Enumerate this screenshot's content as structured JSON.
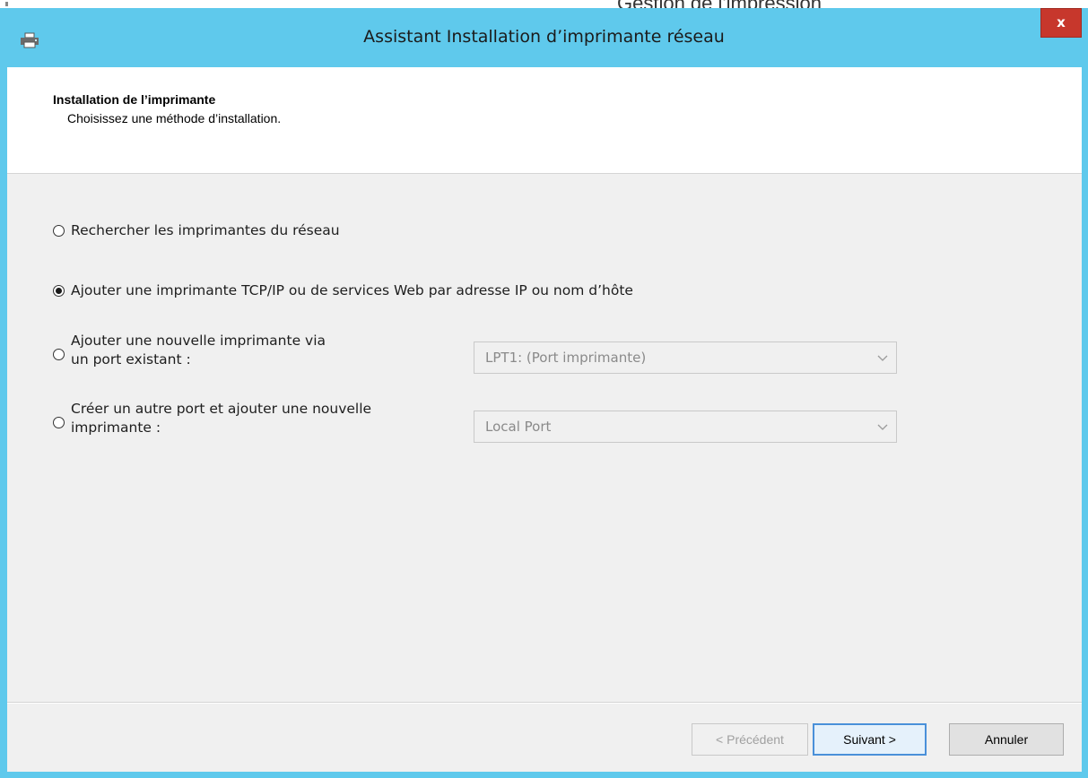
{
  "background_window": {
    "title": "Gestion de l'impression"
  },
  "dialog": {
    "title": "Assistant Installation d’imprimante réseau",
    "close_label": "x",
    "header": {
      "title": "Installation de l’imprimante",
      "subtitle": "Choisissez une méthode d’installation."
    },
    "options": [
      {
        "label": "Rechercher les imprimantes du réseau",
        "selected": false
      },
      {
        "label": "Ajouter une imprimante TCP/IP ou de services Web par adresse IP ou nom d’hôte",
        "selected": true
      },
      {
        "label_line1": "Ajouter une nouvelle imprimante via",
        "label_line2": "un port existant :",
        "selected": false,
        "combo_value": "LPT1: (Port imprimante)",
        "combo_enabled": false
      },
      {
        "label_line1": "Créer un autre port et ajouter une nouvelle",
        "label_line2": "imprimante :",
        "selected": false,
        "combo_value": "Local Port",
        "combo_enabled": false
      }
    ],
    "buttons": {
      "back": "< Précédent",
      "next": "Suivant >",
      "cancel": "Annuler"
    }
  },
  "colors": {
    "frame": "#5fc9ec",
    "close_button": "#c7372c",
    "client_bg": "#f0f0f0"
  }
}
